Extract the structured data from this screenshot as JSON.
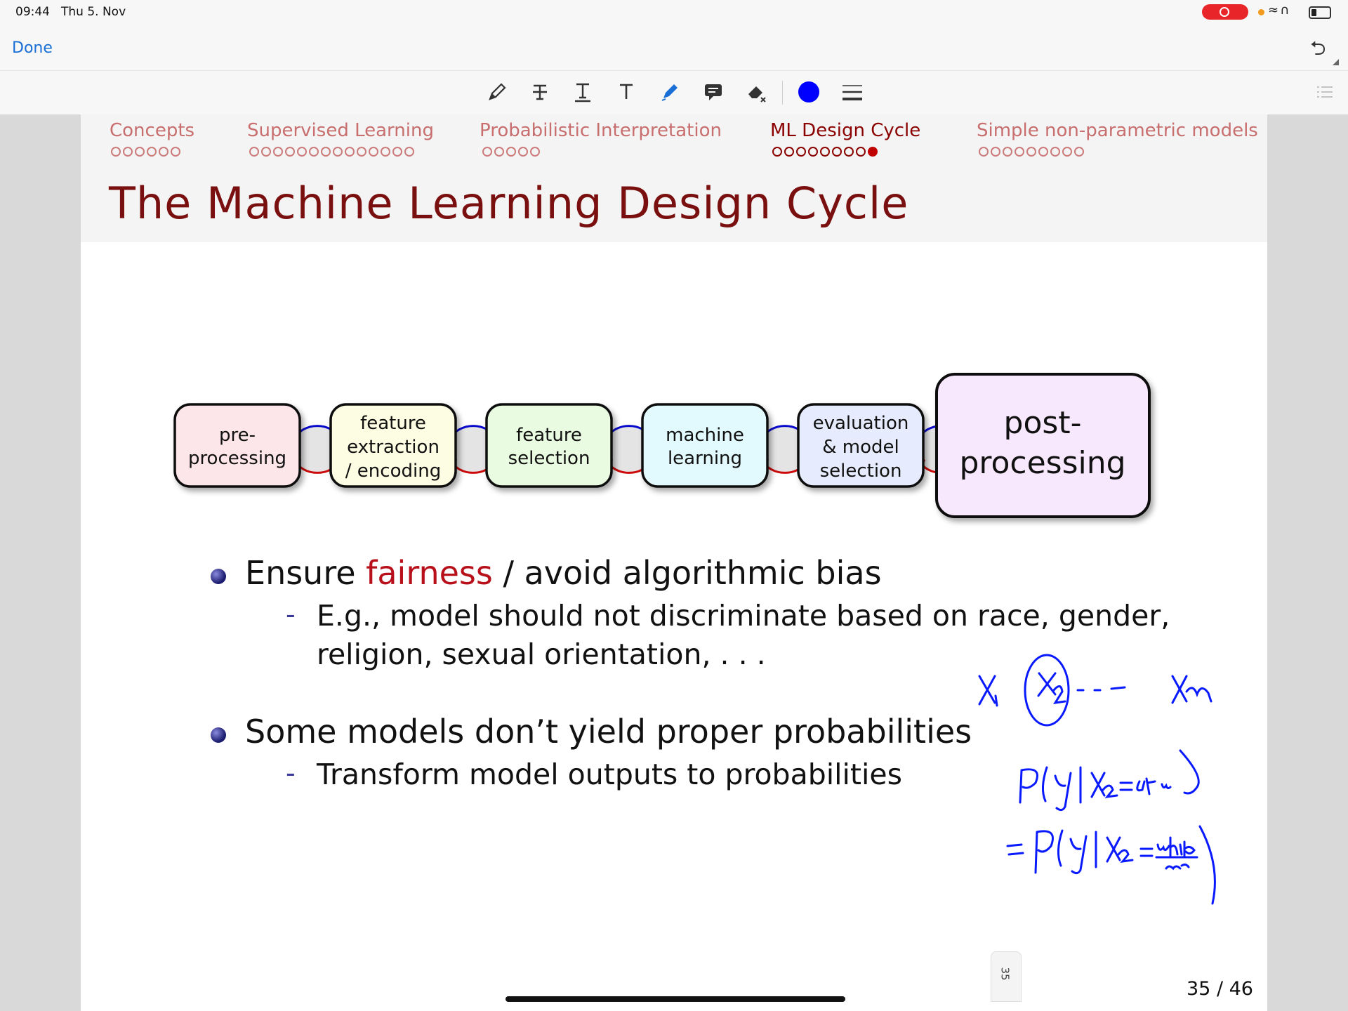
{
  "status": {
    "time": "09:44",
    "date": "Thu 5. Nov"
  },
  "nav": {
    "done_label": "Done",
    "undo_icon": "undo-arrow-icon"
  },
  "toolbar": {
    "tools": [
      "pen-icon",
      "strikethrough-text-icon",
      "underline-text-icon",
      "text-icon",
      "highlighter-icon",
      "comment-icon",
      "eraser-icon",
      "color-picker-icon",
      "line-weight-icon"
    ],
    "active_color": "#0000ff"
  },
  "slide": {
    "sections": [
      {
        "label": "Concepts",
        "dots": 6
      },
      {
        "label": "Supervised Learning",
        "dots": 14
      },
      {
        "label": "Probabilistic Interpretation",
        "dots": 5
      },
      {
        "label": "ML Design Cycle",
        "dots": 9,
        "current": 9
      },
      {
        "label": "Simple non-parametric models",
        "dots": 9
      }
    ],
    "title": "The Machine Learning Design Cycle",
    "cycle": [
      {
        "lines": [
          "pre-",
          "processing"
        ],
        "color": "#fde6ea"
      },
      {
        "lines": [
          "feature",
          "extraction",
          "/ encoding"
        ],
        "color": "#fdfde3"
      },
      {
        "lines": [
          "feature",
          "selection"
        ],
        "color": "#e9fbe0"
      },
      {
        "lines": [
          "machine",
          "learning"
        ],
        "color": "#e2fafd"
      },
      {
        "lines": [
          "evaluation",
          "& model",
          "selection"
        ],
        "color": "#e6ecfd"
      },
      {
        "lines": [
          "post-",
          "processing"
        ],
        "color": "#f8e8fd"
      }
    ],
    "bullet1": {
      "pre": "Ensure ",
      "highlight": "fairness",
      "post": " / avoid algorithmic bias"
    },
    "bullet1_sub": [
      "E.g., model should not discriminate based on race, gender,",
      "religion, sexual orientation, . . ."
    ],
    "bullet2": "Some models don’t yield proper probabilities",
    "bullet2_sub": "Transform model outputs to probabilities",
    "thumb_label": "35",
    "page": "35 / 46"
  },
  "annotation": {
    "ink_color": "#0a1aff",
    "lines": [
      "X₁  (X₂) - - -  X_m",
      "P(y | X₂ = af.am )",
      "= P(y | X₂ = white man)"
    ]
  }
}
